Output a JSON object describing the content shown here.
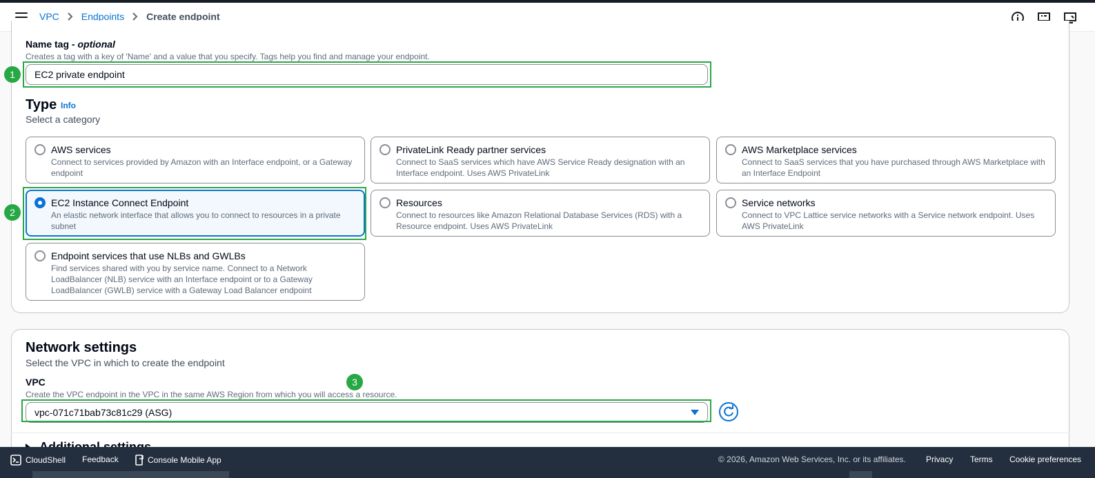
{
  "breadcrumb": {
    "items": [
      "VPC",
      "Endpoints"
    ],
    "current": "Create endpoint"
  },
  "name_tag": {
    "label": "Name tag",
    "optional": "optional",
    "description": "Creates a tag with a key of 'Name' and a value that you specify. Tags help you find and manage your endpoint.",
    "value": "EC2 private endpoint"
  },
  "type": {
    "title": "Type",
    "info": "Info",
    "subtitle": "Select a category",
    "options": [
      {
        "title": "AWS services",
        "desc": "Connect to services provided by Amazon with an Interface endpoint, or a Gateway endpoint",
        "selected": false
      },
      {
        "title": "PrivateLink Ready partner services",
        "desc": "Connect to SaaS services which have AWS Service Ready designation with an Interface endpoint. Uses AWS PrivateLink",
        "selected": false
      },
      {
        "title": "AWS Marketplace services",
        "desc": "Connect to SaaS services that you have purchased through AWS Marketplace with an Interface Endpoint",
        "selected": false
      },
      {
        "title": "EC2 Instance Connect Endpoint",
        "desc": "An elastic network interface that allows you to connect to resources in a private subnet",
        "selected": true
      },
      {
        "title": "Resources",
        "desc": "Connect to resources like Amazon Relational Database Services (RDS) with a Resource endpoint. Uses AWS PrivateLink",
        "selected": false
      },
      {
        "title": "Service networks",
        "desc": "Connect to VPC Lattice service networks with a Service network endpoint. Uses AWS PrivateLink",
        "selected": false
      },
      {
        "title": "Endpoint services that use NLBs and GWLBs",
        "desc": "Find services shared with you by service name. Connect to a Network LoadBalancer (NLB) service with an Interface endpoint or to a Gateway LoadBalancer (GWLB) service with a Gateway Load Balancer endpoint",
        "selected": false
      }
    ]
  },
  "network": {
    "title": "Network settings",
    "subtitle": "Select the VPC in which to create the endpoint",
    "vpc_label": "VPC",
    "vpc_desc": "Create the VPC endpoint in the VPC in the same AWS Region from which you will access a resource.",
    "vpc_value": "vpc-071c71bab73c81c29 (ASG)",
    "additional": "Additional settings"
  },
  "annotations": [
    "1",
    "2",
    "3"
  ],
  "footer": {
    "cloudshell": "CloudShell",
    "feedback": "Feedback",
    "mobile_app": "Console Mobile App",
    "copyright": "© 2026, Amazon Web Services, Inc. or its affiliates.",
    "privacy": "Privacy",
    "terms": "Terms",
    "cookies": "Cookie preferences"
  },
  "colors": {
    "accent": "#0972d3",
    "highlight": "#27a844",
    "footer_bg": "#232f3e"
  },
  "icons": [
    "menu-icon",
    "chevron-right-icon",
    "info-icon",
    "feedback-icon",
    "display-icon",
    "refresh-icon",
    "terminal-icon",
    "mobile-icon"
  ]
}
